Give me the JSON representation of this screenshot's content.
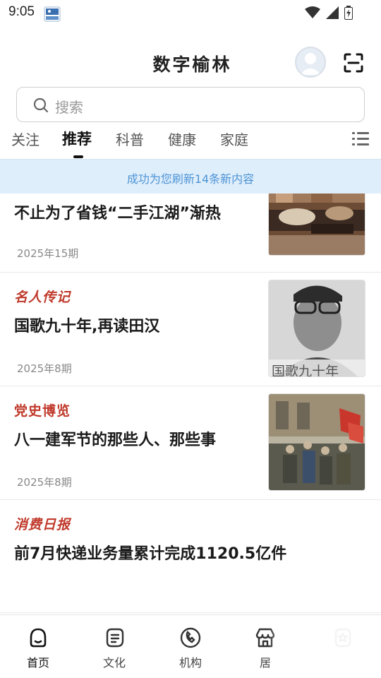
{
  "status_bar": {
    "time": "9:05",
    "icons": [
      "app-notification-icon",
      "wifi-icon",
      "signal-icon",
      "battery-icon"
    ]
  },
  "header": {
    "title": "数字榆林",
    "icons": [
      "avatar",
      "scan-icon"
    ]
  },
  "search": {
    "placeholder": "搜索"
  },
  "tabs": {
    "items": [
      {
        "label": "关注"
      },
      {
        "label": "推荐"
      },
      {
        "label": "科普"
      },
      {
        "label": "健康"
      },
      {
        "label": "家庭"
      }
    ],
    "active": "推荐",
    "menu_icon": "list-menu-icon"
  },
  "refresh_notice": "成功为您刷新14条新内容",
  "feed": {
    "items": [
      {
        "source": "",
        "title": "不止为了省钱“二手江湖”渐热",
        "date": "2025年15期",
        "thumb_text": ""
      },
      {
        "source": "名人传记",
        "title": "国歌九十年,再读田汉",
        "date": "2025年8期",
        "thumb_text": "国歌九十年"
      },
      {
        "source": "党史博览",
        "title": "八一建军节的那些人、那些事",
        "date": "2025年8期",
        "thumb_text": ""
      },
      {
        "source": "消费日报",
        "title": "前7月快递业务量累计完成1120.5亿件",
        "date": "",
        "thumb_text": ""
      }
    ]
  },
  "bottom_nav": {
    "items": [
      {
        "label": "首页",
        "icon": "home-icon"
      },
      {
        "label": "文化",
        "icon": "culture-icon"
      },
      {
        "label": "机构",
        "icon": "phone-icon"
      },
      {
        "label": "居",
        "icon": "shop-icon"
      },
      {
        "label": "",
        "icon": "profile-icon"
      }
    ],
    "active": "首页"
  },
  "colors": {
    "accent_red": "#c0392b",
    "refresh_bg": "#dfeefb",
    "refresh_text": "#4d94d6"
  }
}
